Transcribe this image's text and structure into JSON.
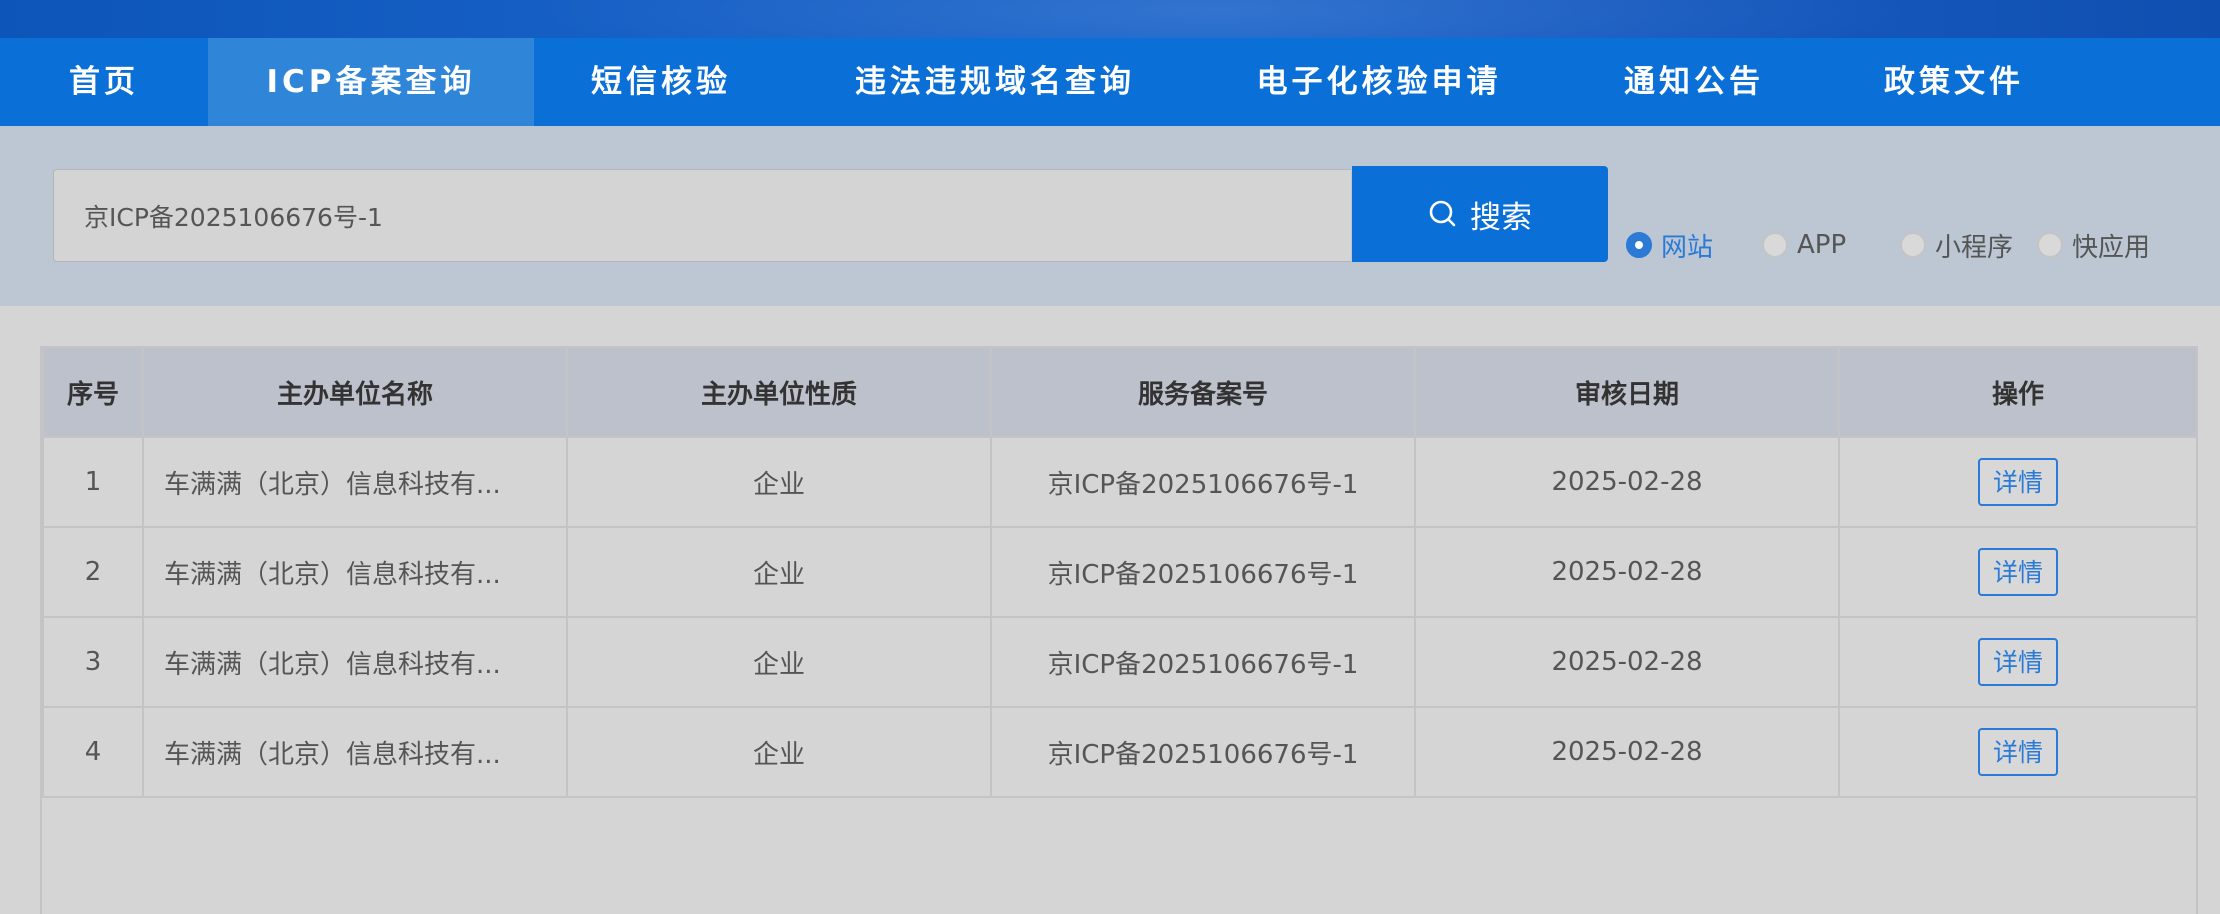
{
  "nav": {
    "items": [
      {
        "label": "首页"
      },
      {
        "label": "ICP备案查询"
      },
      {
        "label": "短信核验"
      },
      {
        "label": "违法违规域名查询"
      },
      {
        "label": "电子化核验申请"
      },
      {
        "label": "通知公告"
      },
      {
        "label": "政策文件"
      }
    ],
    "active": "ICP备案查询"
  },
  "search": {
    "value": "京ICP备2025106676号-1",
    "button_label": "搜索",
    "button_icon": "search-icon",
    "options": [
      {
        "label": "网站",
        "checked": true
      },
      {
        "label": "APP",
        "checked": false
      },
      {
        "label": "小程序",
        "checked": false
      },
      {
        "label": "快应用",
        "checked": false
      }
    ]
  },
  "table": {
    "headers": [
      "序号",
      "主办单位名称",
      "主办单位性质",
      "服务备案号",
      "审核日期",
      "操作"
    ],
    "rows": [
      {
        "index": "1",
        "org_name": "车满满（北京）信息科技有...",
        "org_type": "企业",
        "record_no": "京ICP备2025106676号-1",
        "date": "2025-02-28",
        "action": "详情"
      },
      {
        "index": "2",
        "org_name": "车满满（北京）信息科技有...",
        "org_type": "企业",
        "record_no": "京ICP备2025106676号-1",
        "date": "2025-02-28",
        "action": "详情"
      },
      {
        "index": "3",
        "org_name": "车满满（北京）信息科技有...",
        "org_type": "企业",
        "record_no": "京ICP备2025106676号-1",
        "date": "2025-02-28",
        "action": "详情"
      },
      {
        "index": "4",
        "org_name": "车满满（北京）信息科技有...",
        "org_type": "企业",
        "record_no": "京ICP备2025106676号-1",
        "date": "2025-02-28",
        "action": "详情"
      }
    ]
  },
  "colors": {
    "nav_bg": "#0a6fd6",
    "nav_active_bg": "#2f86d9",
    "accent": "#2a7ad6",
    "search_band_bg": "#bcc7d3",
    "table_header_bg": "#bdc1cb",
    "page_bg": "#d5d5d5"
  }
}
